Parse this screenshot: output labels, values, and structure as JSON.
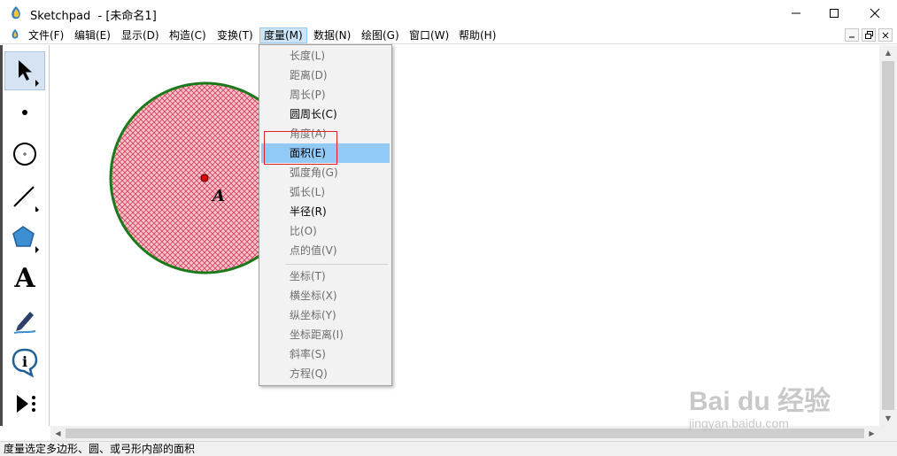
{
  "window": {
    "app_name": "Sketchpad",
    "title": "Sketchpad  - [未命名1]"
  },
  "menubar": {
    "items": [
      {
        "label": "文件(F)"
      },
      {
        "label": "编辑(E)"
      },
      {
        "label": "显示(D)"
      },
      {
        "label": "构造(C)"
      },
      {
        "label": "变换(T)"
      },
      {
        "label": "度量(M)"
      },
      {
        "label": "数据(N)"
      },
      {
        "label": "绘图(G)"
      },
      {
        "label": "窗口(W)"
      },
      {
        "label": "帮助(H)"
      }
    ],
    "active": "度量(M)"
  },
  "toolbar": {
    "tools": [
      {
        "name": "arrow-tool",
        "icon": "arrow-select-icon",
        "selected": true
      },
      {
        "name": "point-tool",
        "icon": "point-icon"
      },
      {
        "name": "compass-tool",
        "icon": "circle-compass-icon"
      },
      {
        "name": "straightedge-tool",
        "icon": "line-segment-icon"
      },
      {
        "name": "polygon-tool",
        "icon": "pentagon-icon"
      },
      {
        "name": "text-tool",
        "icon": "text-a-icon",
        "glyph": "A"
      },
      {
        "name": "marker-tool",
        "icon": "marker-pen-icon"
      },
      {
        "name": "information-tool",
        "icon": "info-icon",
        "glyph": "i"
      },
      {
        "name": "custom-tool",
        "icon": "custom-tool-icon"
      }
    ]
  },
  "canvas": {
    "point_label": "A",
    "circle_fill_color": "#f9c4c4",
    "circle_stroke_color": "#1a7a1a",
    "point_color": "#e00000"
  },
  "measure_menu": {
    "items": [
      {
        "label": "长度(L)",
        "enabled": false
      },
      {
        "label": "距离(D)",
        "enabled": false
      },
      {
        "label": "周长(P)",
        "enabled": false
      },
      {
        "label": "圆周长(C)",
        "enabled": true
      },
      {
        "label": "角度(A)",
        "enabled": false
      },
      {
        "label": "面积(E)",
        "enabled": true,
        "highlighted": true
      },
      {
        "label": "弧度角(G)",
        "enabled": false
      },
      {
        "label": "弧长(L)",
        "enabled": false
      },
      {
        "label": "半径(R)",
        "enabled": true
      },
      {
        "label": "比(O)",
        "enabled": false
      },
      {
        "label": "点的值(V)",
        "enabled": false
      },
      {
        "label": "坐标(T)",
        "enabled": false
      },
      {
        "label": "横坐标(X)",
        "enabled": false
      },
      {
        "label": "纵坐标(Y)",
        "enabled": false
      },
      {
        "label": "坐标距离(I)",
        "enabled": false
      },
      {
        "label": "斜率(S)",
        "enabled": false
      },
      {
        "label": "方程(Q)",
        "enabled": false
      }
    ],
    "highlight_color": "#91c9f7",
    "annotation_color": "#e02020"
  },
  "statusbar": {
    "text": "度量选定多边形、圆、或弓形内部的面积"
  },
  "watermark": {
    "logo": "Bai du 经验",
    "url": "jingyan.baidu.com"
  }
}
